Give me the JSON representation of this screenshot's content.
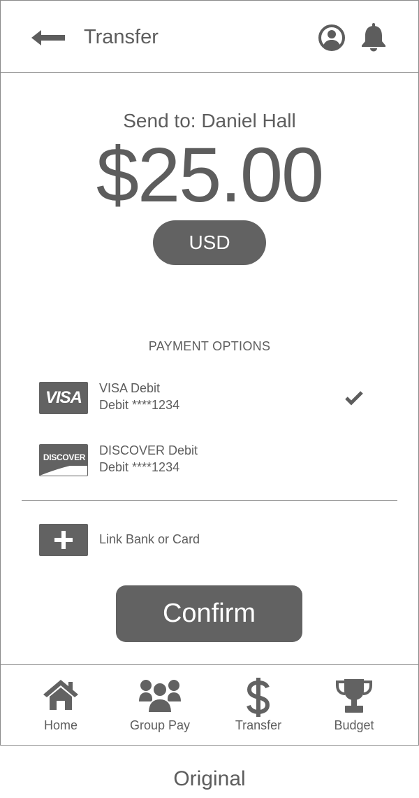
{
  "header": {
    "title": "Transfer",
    "back_icon": "back-arrow-icon",
    "profile_icon": "user-circle-icon",
    "notifications_icon": "bell-icon"
  },
  "transfer": {
    "send_to": "Send to: Daniel Hall",
    "amount": "$25.00",
    "currency": "USD"
  },
  "payment": {
    "heading": "PAYMENT OPTIONS",
    "options": [
      {
        "brand": "VISA",
        "name": "VISA Debit",
        "detail": "Debit ****1234",
        "selected": true
      },
      {
        "brand": "DISCOVER",
        "name": "DISCOVER Debit",
        "detail": "Debit ****1234",
        "selected": false
      }
    ],
    "link_label": "Link Bank or Card"
  },
  "confirm_label": "Confirm",
  "nav": {
    "items": [
      {
        "label": "Home",
        "icon": "home-icon"
      },
      {
        "label": "Group Pay",
        "icon": "group-icon"
      },
      {
        "label": "Transfer",
        "icon": "dollar-icon"
      },
      {
        "label": "Budget",
        "icon": "trophy-icon"
      }
    ]
  },
  "caption": "Original",
  "colors": {
    "primary": "#626262",
    "text": "#5d5d5d",
    "border": "#8a8a8a",
    "background": "#ffffff"
  }
}
